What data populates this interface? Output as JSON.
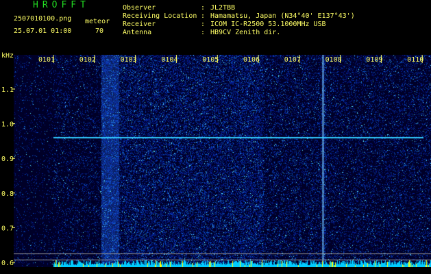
{
  "header": {
    "app_title": "HROFFT",
    "filename": "2507010100.png",
    "timestamp": "25.07.01 01:00",
    "detect_label": "meteor",
    "detect_count": "70",
    "info": [
      {
        "label": "Observer",
        "value": "JL2TBB"
      },
      {
        "label": "Receiving Location",
        "value": "Hamamatsu, Japan (N34°40' E137°43')"
      },
      {
        "label": "Receiver",
        "value": "ICOM IC-R2500 53.1000MHz USB"
      },
      {
        "label": "Antenna",
        "value": "HB9CV Zenith dir."
      }
    ],
    "separator": ":"
  },
  "spectrogram": {
    "y_unit": "kHz",
    "y_ticks": [
      "1.1",
      "1.0",
      "0.9",
      "0.8",
      "0.7",
      "0.6"
    ],
    "x_ticks": [
      "0101",
      "0102",
      "0103",
      "0104",
      "0105",
      "0106",
      "0107",
      "0108",
      "0109",
      "0110"
    ],
    "colors": {
      "bg": "#000030",
      "signal": "#33ccff",
      "tick": "#ffff66",
      "bar": "#ffff00"
    }
  }
}
